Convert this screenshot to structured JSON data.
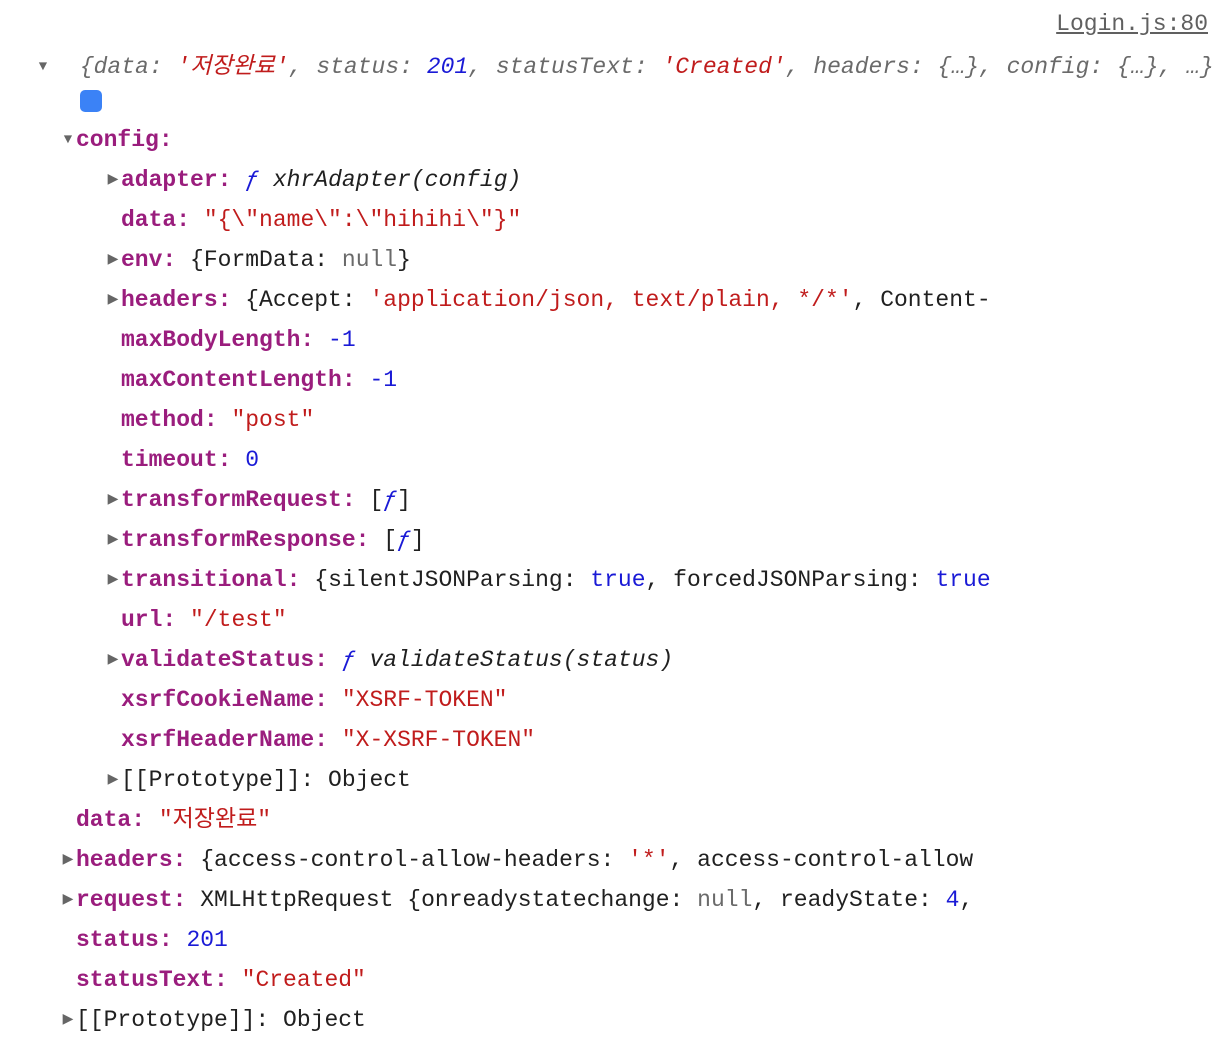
{
  "source": "Login.js:80",
  "summary": {
    "data_k": "data:",
    "data_v": "'저장완료'",
    "status_k": "status:",
    "status_v": "201",
    "statusText_k": "statusText:",
    "statusText_v": "'Created'",
    "headers_k": "headers:",
    "headers_v": "{…}",
    "config_k": "config:",
    "config_v": "{…}",
    "rest": "…"
  },
  "info_badge": "i",
  "c": {
    "config": "config:",
    "adapter_k": "adapter:",
    "adapter_f": "ƒ",
    "adapter_sig": "xhrAdapter(config)",
    "data_k": "data:",
    "data_v": "\"{\\\"name\\\":\\\"hihihi\\\"}\"",
    "env_k": "env:",
    "env_brace_l": "{",
    "env_fd_k": "FormData:",
    "env_fd_v": "null",
    "env_brace_r": "}",
    "headers_k": "headers:",
    "headers_brace_l": "{",
    "headers_accept_k": "Accept:",
    "headers_accept_v": "'application/json, text/plain, */*'",
    "headers_ct_k": "Content-",
    "maxBody_k": "maxBodyLength:",
    "maxBody_v": "-1",
    "maxContent_k": "maxContentLength:",
    "maxContent_v": "-1",
    "method_k": "method:",
    "method_v": "\"post\"",
    "timeout_k": "timeout:",
    "timeout_v": "0",
    "treq_k": "transformRequest:",
    "treq_sig": "ƒ",
    "treq_l": "[",
    "treq_r": "]",
    "tres_k": "transformResponse:",
    "tres_sig": "ƒ",
    "tres_l": "[",
    "tres_r": "]",
    "trans_k": "transitional:",
    "trans_brace_l": "{",
    "trans_sj_k": "silentJSONParsing:",
    "trans_sj_v": "true",
    "trans_fj_k": "forcedJSONParsing:",
    "trans_fj_v": "true",
    "url_k": "url:",
    "url_v": "\"/test\"",
    "vstatus_k": "validateStatus:",
    "vstatus_f": "ƒ",
    "vstatus_sig": "validateStatus(status)",
    "xcookie_k": "xsrfCookieName:",
    "xcookie_v": "\"XSRF-TOKEN\"",
    "xheader_k": "xsrfHeaderName:",
    "xheader_v": "\"X-XSRF-TOKEN\"",
    "proto_k": "[[Prototype]]:",
    "proto_v": "Object"
  },
  "top": {
    "data_k": "data:",
    "data_v": "\"저장완료\"",
    "headers_k": "headers:",
    "headers_brace_l": "{",
    "headers_acah_k": "access-control-allow-headers:",
    "headers_acah_v": "'*'",
    "headers_acao_k": "access-control-allow",
    "request_k": "request:",
    "request_type": "XMLHttpRequest",
    "request_brace_l": "{",
    "request_orsc_k": "onreadystatechange:",
    "request_orsc_v": "null",
    "request_rs_k": "readyState:",
    "request_rs_v": "4",
    "status_k": "status:",
    "status_v": "201",
    "statusText_k": "statusText:",
    "statusText_v": "\"Created\"",
    "proto_k": "[[Prototype]]:",
    "proto_v": "Object"
  },
  "comma": ","
}
